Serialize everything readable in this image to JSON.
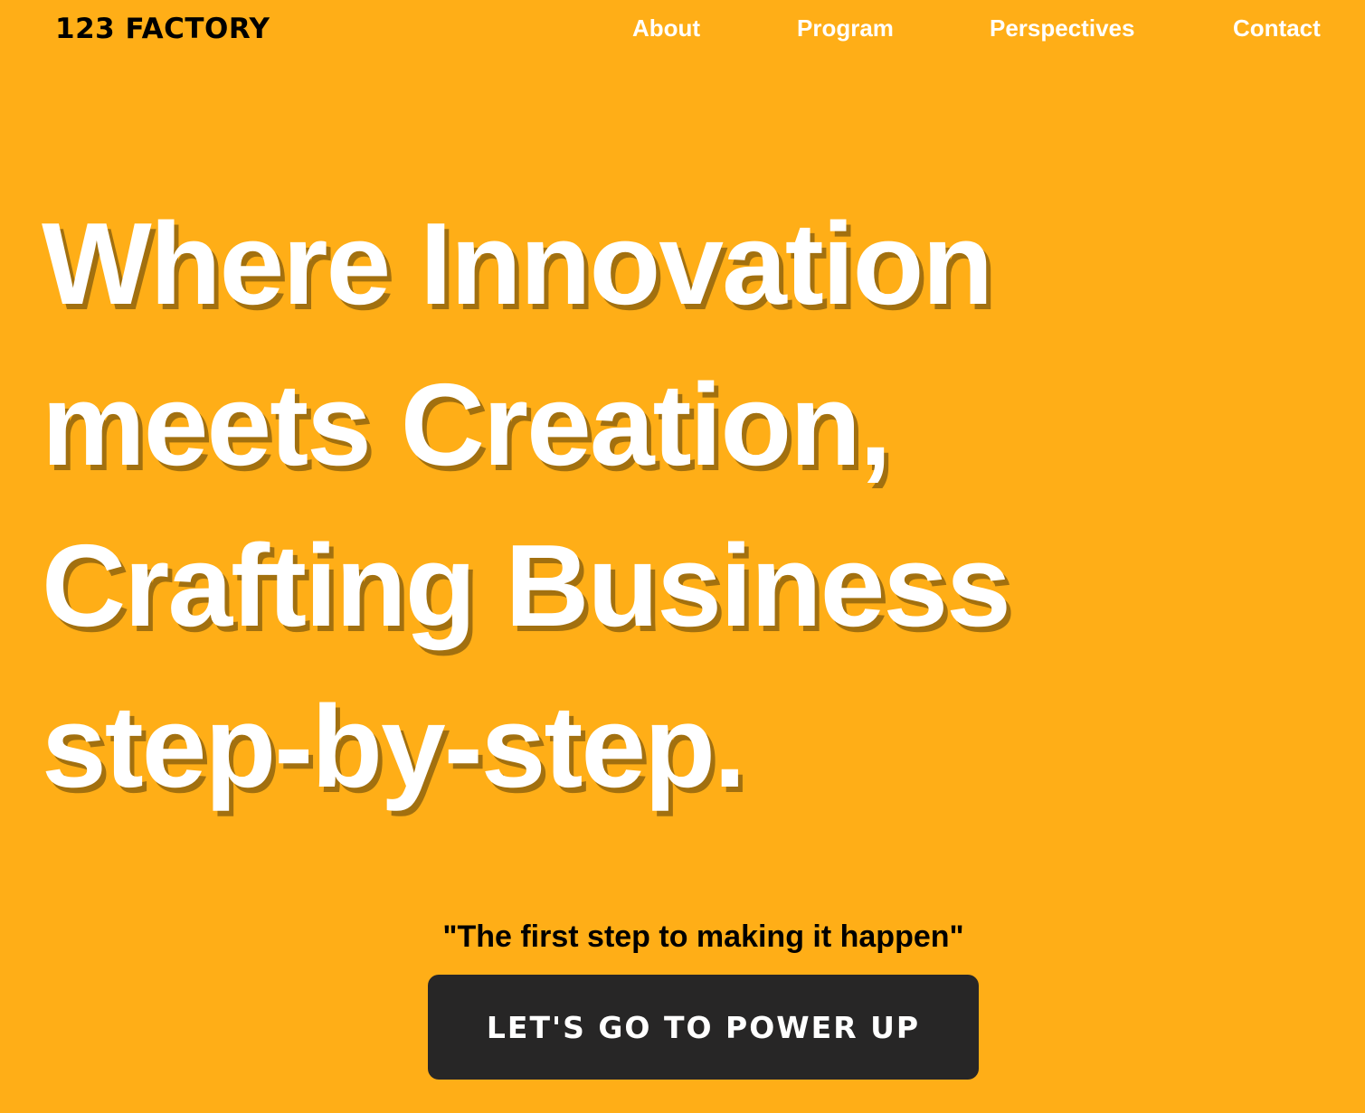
{
  "header": {
    "logo": "123 FACTORY",
    "nav": [
      "About",
      "Program",
      "Perspectives",
      "Contact"
    ]
  },
  "hero": {
    "lines": [
      "Where Innovation",
      "meets Creation,",
      "Crafting Business",
      "step-by-step."
    ],
    "quote": "\"The first step to making it happen\"",
    "cta_label": "LET'S GO TO POWER UP"
  },
  "colors": {
    "background": "#FFAE17",
    "button": "#272626",
    "text": "#FFFFFF"
  }
}
